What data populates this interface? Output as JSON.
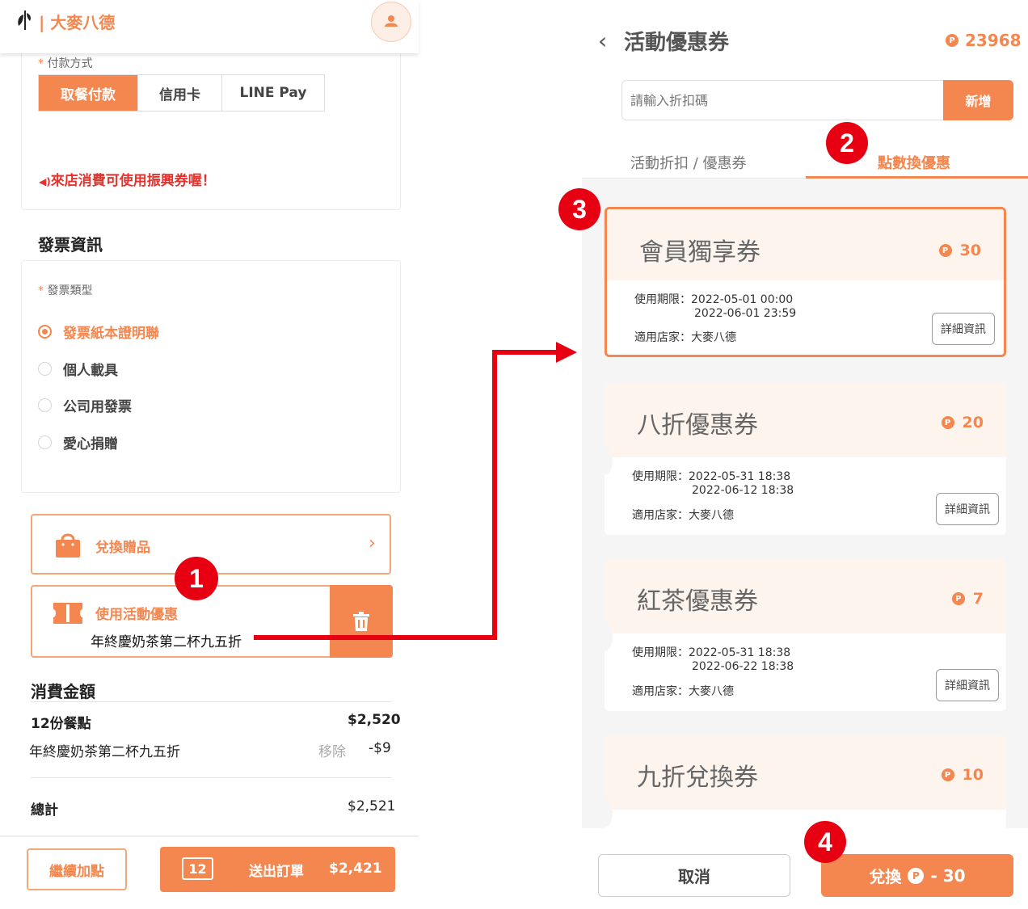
{
  "left": {
    "header": {
      "brand": "| 大麥八德"
    },
    "payment": {
      "label": "付款方式",
      "tabs": [
        "取餐付款",
        "信用卡",
        "LINE Pay"
      ],
      "notice": "來店消費可使用振興券喔！"
    },
    "invoice": {
      "title": "發票資訊",
      "type_label": "發票類型",
      "options": [
        "發票紙本證明聯",
        "個人載具",
        "公司用發票",
        "愛心捐贈"
      ]
    },
    "redeem_gift": "兌換贈品",
    "promo": {
      "label": "使用活動優惠",
      "applied": "年終慶奶茶第二杯九五折"
    },
    "summary": {
      "title": "消費金額",
      "items_label": "12份餐點",
      "items_amount": "$2,520",
      "discount_label": "年終慶奶茶第二杯九五折",
      "remove": "移除",
      "discount_amount": "-$9",
      "total_label": "總計",
      "total_amount": "$2,521"
    },
    "bottom": {
      "continue": "繼續加點",
      "count": "12",
      "submit": "送出訂單",
      "submit_total": "$2,421"
    }
  },
  "right": {
    "title": "活動優惠券",
    "points": "23968",
    "code_placeholder": "請輸入折扣碼",
    "add": "新增",
    "tabs": [
      "活動折扣 / 優惠券",
      "點數換優惠"
    ],
    "coupons": [
      {
        "name": "會員獨享券",
        "points": "30",
        "validity_label": "使用期限：",
        "start": "2022-05-01 00:00",
        "end": "2022-06-01 23:59",
        "store": "適用店家：大麥八德",
        "details": "詳細資訊"
      },
      {
        "name": "八折優惠券",
        "points": "20",
        "validity_label": "使用期限：",
        "start": "2022-05-31 18:38",
        "end": "2022-06-12 18:38",
        "store": "適用店家：大麥八德",
        "details": "詳細資訊"
      },
      {
        "name": "紅茶優惠券",
        "points": "7",
        "validity_label": "使用期限：",
        "start": "2022-05-31 18:38",
        "end": "2022-06-22 18:38",
        "store": "適用店家：大麥八德",
        "details": "詳細資訊"
      },
      {
        "name": "九折兌換券",
        "points": "10"
      }
    ],
    "cancel": "取消",
    "exchange": "兌換",
    "exchange_points": "- 30"
  },
  "steps": [
    "1",
    "2",
    "3",
    "4"
  ],
  "colors": {
    "accent": "#f4874f",
    "step_badge": "#e60012",
    "arrow": "#e60012"
  }
}
